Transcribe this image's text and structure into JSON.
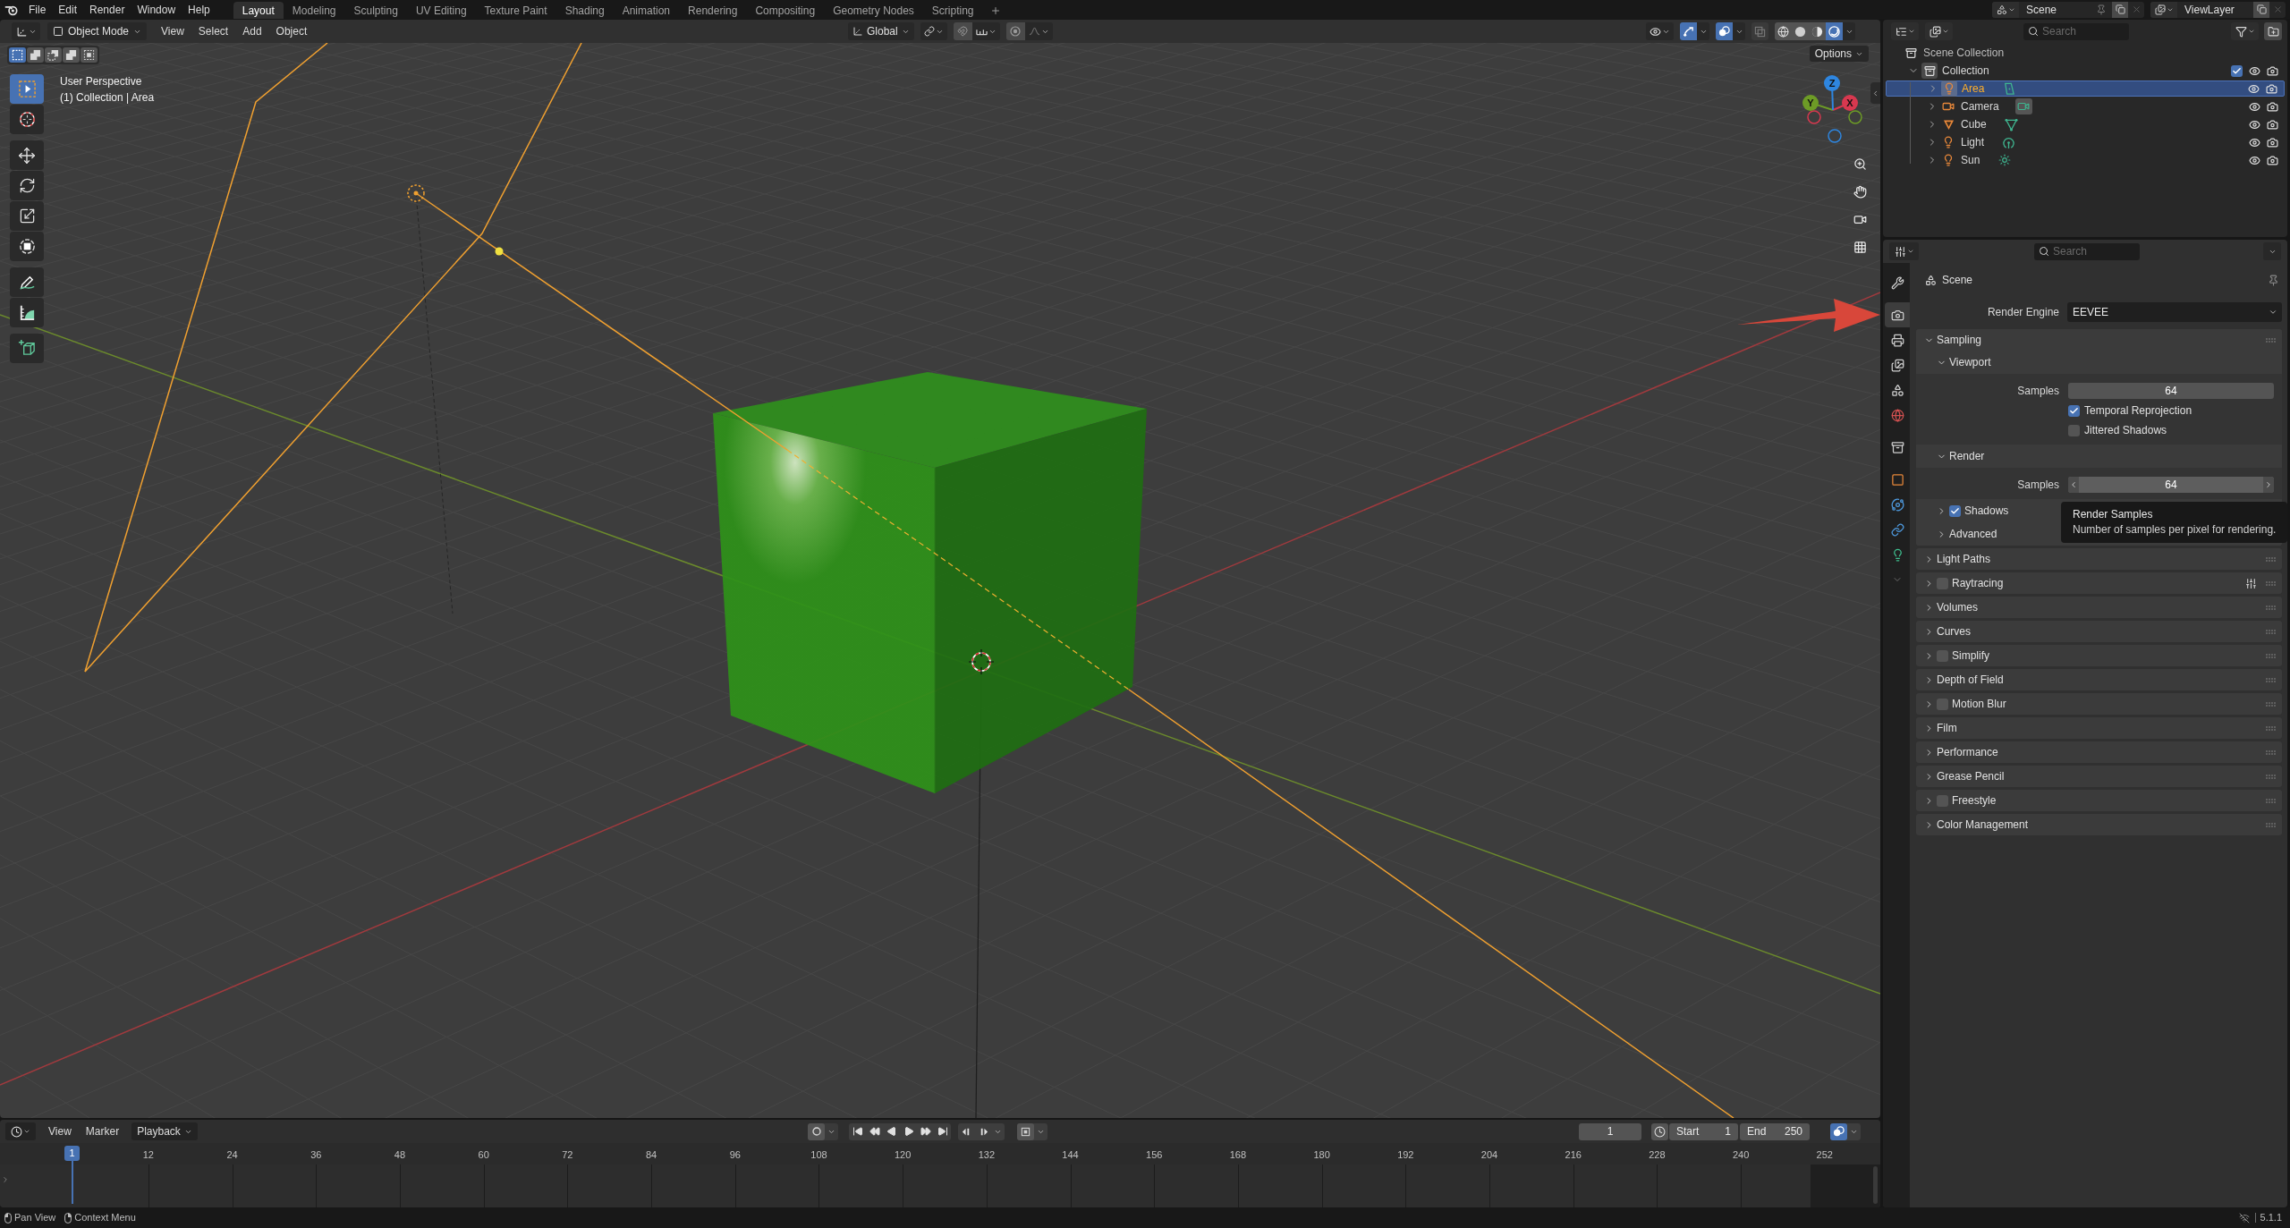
{
  "top_bar": {
    "menus": [
      "File",
      "Edit",
      "Render",
      "Window",
      "Help"
    ],
    "workspaces": [
      {
        "label": "Layout",
        "selected": true
      },
      {
        "label": "Modeling",
        "selected": false
      },
      {
        "label": "Sculpting",
        "selected": false
      },
      {
        "label": "UV Editing",
        "selected": false
      },
      {
        "label": "Texture Paint",
        "selected": false
      },
      {
        "label": "Shading",
        "selected": false
      },
      {
        "label": "Animation",
        "selected": false
      },
      {
        "label": "Rendering",
        "selected": false
      },
      {
        "label": "Compositing",
        "selected": false
      },
      {
        "label": "Geometry Nodes",
        "selected": false
      },
      {
        "label": "Scripting",
        "selected": false
      }
    ],
    "scene": "Scene",
    "view_layer": "ViewLayer"
  },
  "viewport": {
    "header": {
      "mode": "Object Mode",
      "menus": [
        "View",
        "Select",
        "Add",
        "Object"
      ],
      "orientation": "Global",
      "toggles": [
        {
          "kind": "gizmos",
          "on": true
        },
        {
          "kind": "overlays",
          "on": true
        },
        {
          "kind": "xray",
          "on": false
        }
      ],
      "shading": [
        {
          "kind": "wireframe",
          "selected": false
        },
        {
          "kind": "solid",
          "selected": false
        },
        {
          "kind": "material",
          "selected": false
        },
        {
          "kind": "rendered",
          "selected": true
        }
      ]
    },
    "select_modes": [
      {
        "kind": "set",
        "selected": true
      },
      {
        "kind": "extend",
        "selected": false
      },
      {
        "kind": "subtract",
        "selected": false
      },
      {
        "kind": "invert",
        "selected": false
      },
      {
        "kind": "intersect",
        "selected": false
      }
    ],
    "tool_groups": [
      {
        "tools": [
          {
            "kind": "select_box",
            "selected": true
          },
          {
            "kind": "cursor",
            "selected": false
          }
        ]
      },
      {
        "tools": [
          {
            "kind": "move",
            "selected": false
          },
          {
            "kind": "rotate",
            "selected": false
          },
          {
            "kind": "scale",
            "selected": false
          },
          {
            "kind": "transform",
            "selected": false
          }
        ]
      },
      {
        "tools": [
          {
            "kind": "annotate",
            "selected": false
          },
          {
            "kind": "measure",
            "selected": false
          }
        ]
      },
      {
        "tools": [
          {
            "kind": "add_cube",
            "selected": false
          }
        ]
      }
    ],
    "info": [
      "User Perspective",
      "(1) Collection | Area"
    ],
    "options": "Options",
    "gizmo": [
      {
        "label": "X",
        "color": "#d8384f"
      },
      {
        "label": "Y",
        "color": "#6d9c26"
      },
      {
        "label": "Z",
        "color": "#2e86e0"
      }
    ]
  },
  "outliner": {
    "search": {
      "placeholder": "Search"
    },
    "root": {
      "label": "Scene Collection",
      "children": [
        {
          "label": "Collection",
          "expanded": true,
          "checked": true,
          "children": [
            {
              "label": "Area",
              "kind": "area",
              "expanded": false,
              "selected": true,
              "data_active": false
            },
            {
              "label": "Camera",
              "kind": "camera",
              "expanded": false,
              "selected": false,
              "data_active": true
            },
            {
              "label": "Cube",
              "kind": "mesh",
              "expanded": false,
              "selected": false,
              "data_active": false
            },
            {
              "label": "Light",
              "kind": "point",
              "expanded": false,
              "selected": false,
              "data_active": false
            },
            {
              "label": "Sun",
              "kind": "sun",
              "expanded": false,
              "selected": false,
              "data_active": false
            }
          ]
        }
      ]
    }
  },
  "properties": {
    "search": {
      "placeholder": "Search"
    },
    "tab_groups": [
      {
        "tabs": [
          {
            "kind": "tool",
            "selected": false
          }
        ]
      },
      {
        "tabs": [
          {
            "kind": "render",
            "selected": true
          },
          {
            "kind": "output",
            "selected": false
          },
          {
            "kind": "view_layer",
            "selected": false
          },
          {
            "kind": "scene",
            "selected": false
          },
          {
            "kind": "world",
            "selected": false
          }
        ]
      },
      {
        "tabs": [
          {
            "kind": "collection",
            "selected": false
          }
        ]
      },
      {
        "tabs": [
          {
            "kind": "object",
            "selected": false
          },
          {
            "kind": "physics",
            "selected": false
          },
          {
            "kind": "constraints",
            "selected": false
          },
          {
            "kind": "light_data",
            "selected": false
          }
        ]
      }
    ],
    "context": "Scene",
    "render_engine": {
      "label": "Render Engine",
      "value": "EEVEE"
    },
    "panels": [
      {
        "title": "Sampling",
        "expanded": true,
        "subpanels": [
          {
            "title": "Viewport",
            "expanded": true,
            "rows": [
              {
                "kind": "number",
                "label": "Samples",
                "value": "64",
                "hovered": false
              },
              {
                "kind": "checkbox",
                "label": "Temporal Reprojection",
                "checked": true
              },
              {
                "kind": "checkbox",
                "label": "Jittered Shadows",
                "checked": false
              }
            ]
          },
          {
            "title": "Render",
            "expanded": true,
            "rows": [
              {
                "kind": "number",
                "label": "Samples",
                "value": "64",
                "hovered": true
              }
            ]
          },
          {
            "title": "Shadows",
            "expanded": false,
            "checked": true
          },
          {
            "title": "Advanced",
            "expanded": false
          }
        ]
      },
      {
        "title": "Light Paths",
        "expanded": false
      },
      {
        "title": "Raytracing",
        "expanded": false,
        "checked": false,
        "presets": true
      },
      {
        "title": "Volumes",
        "expanded": false
      },
      {
        "title": "Curves",
        "expanded": false
      },
      {
        "title": "Simplify",
        "expanded": false,
        "checked": false
      },
      {
        "title": "Depth of Field",
        "expanded": false
      },
      {
        "title": "Motion Blur",
        "expanded": false,
        "checked": false
      },
      {
        "title": "Film",
        "expanded": false
      },
      {
        "title": "Performance",
        "expanded": false
      },
      {
        "title": "Grease Pencil",
        "expanded": false
      },
      {
        "title": "Freestyle",
        "expanded": false,
        "checked": false
      },
      {
        "title": "Color Management",
        "expanded": false
      }
    ],
    "tooltip": {
      "title": "Render Samples",
      "description": "Number of samples per pixel for rendering."
    }
  },
  "timeline": {
    "menus": [
      "View",
      "Marker"
    ],
    "playback": "Playback",
    "auto_keying": false,
    "current_frame": "1",
    "start": {
      "label": "Start",
      "value": "1"
    },
    "end": {
      "label": "End",
      "value": "250"
    },
    "playhead": "1",
    "frame_labels": [
      "12",
      "24",
      "36",
      "48",
      "60",
      "72",
      "84",
      "96",
      "108",
      "120",
      "132",
      "144",
      "156",
      "168",
      "180",
      "192",
      "204",
      "216",
      "228",
      "240",
      "252"
    ]
  },
  "status_bar": {
    "hints": [
      {
        "kind": "pan",
        "label": "Pan View"
      },
      {
        "kind": "context",
        "label": "Context Menu"
      }
    ],
    "version": "5.1.1"
  }
}
